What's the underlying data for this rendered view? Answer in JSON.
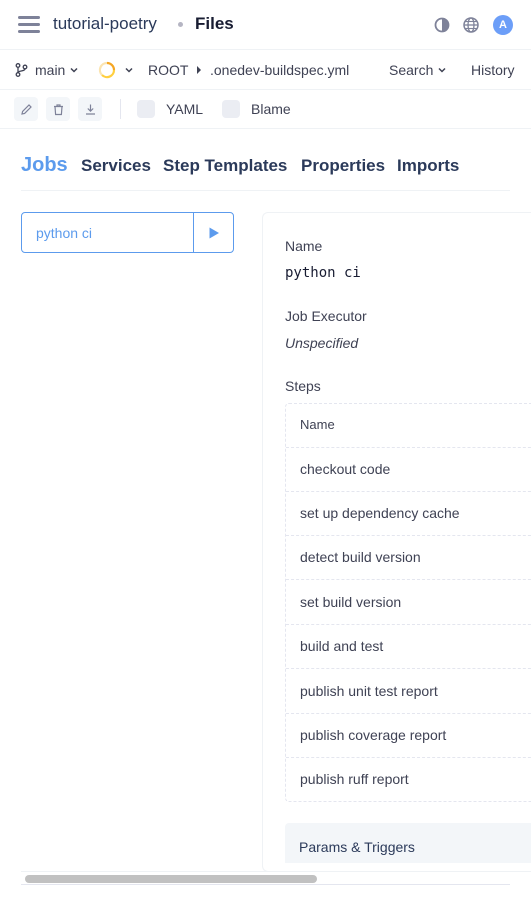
{
  "header": {
    "project": "tutorial-poetry",
    "page": "Files",
    "avatar_initial": "A",
    "icons": [
      "menu-icon",
      "contrast-icon",
      "globe-icon"
    ]
  },
  "nav": {
    "branch": "main",
    "path_root": "ROOT",
    "path_file": ".onedev-buildspec.yml",
    "search_label": "Search",
    "history_label": "History"
  },
  "toolbar": {
    "yaml_label": "YAML",
    "blame_label": "Blame"
  },
  "tabs": [
    "Jobs",
    "Services",
    "Step Templates",
    "Properties",
    "Imports"
  ],
  "job": {
    "selected": "python ci"
  },
  "detail": {
    "name_label": "Name",
    "name_value": "python ci",
    "executor_label": "Job Executor",
    "executor_value": "Unspecified",
    "steps_label": "Steps",
    "steps_header": "Name",
    "steps": [
      "checkout code",
      "set up dependency cache",
      "detect build version",
      "set build version",
      "build and test",
      "publish unit test report",
      "publish coverage report",
      "publish ruff report"
    ],
    "params_label": "Params & Triggers"
  },
  "colors": {
    "accent": "#5c9bed",
    "text": "#3f4254",
    "heading": "#2b3a5a",
    "build_status_orange": "#f5a623",
    "avatar_bg": "#6c9ef8"
  }
}
